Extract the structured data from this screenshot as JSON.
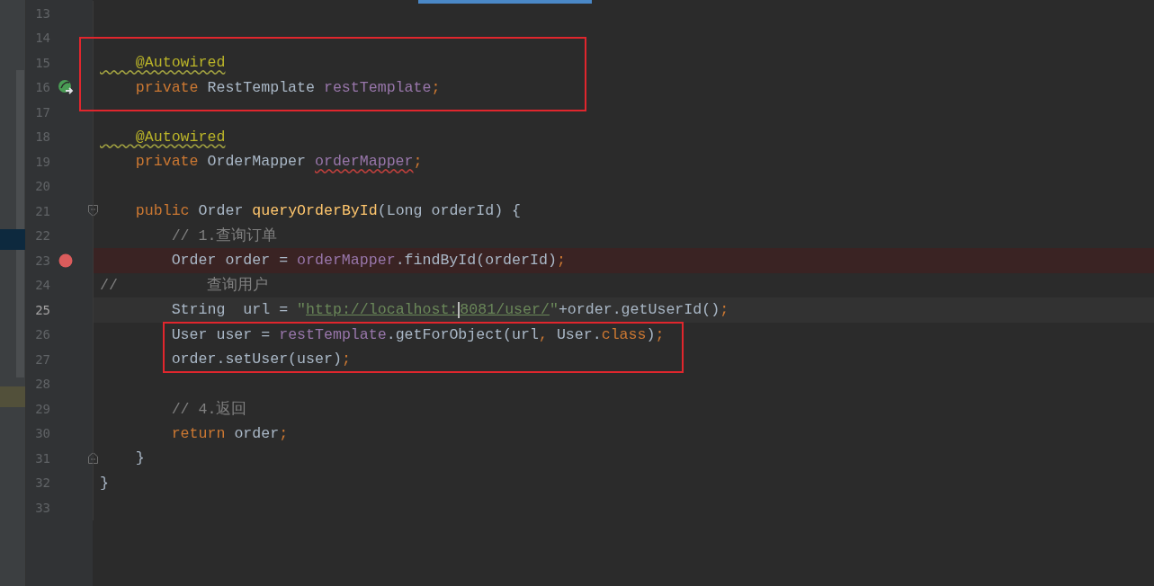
{
  "editor": {
    "sections": [
      {
        "boxed": false,
        "lines": [
          {
            "number": "13",
            "kind": "plain",
            "current": false
          },
          {
            "number": "14",
            "kind": "plain",
            "current": false
          }
        ]
      },
      {
        "boxed": true,
        "lines": [
          {
            "number": "15",
            "kind": "plain",
            "current": false,
            "tokens": [
              {
                "text": "    @Autowired",
                "kind": "annotation",
                "warning": true
              }
            ]
          },
          {
            "number": "16",
            "kind": "bean",
            "current": false,
            "tokens": [
              {
                "text": "    private ",
                "kind": "keyword"
              },
              {
                "text": "RestTemplate ",
                "kind": "plain"
              },
              {
                "text": "restTemplate",
                "kind": "field"
              },
              {
                "text": ";",
                "kind": "keyword"
              }
            ]
          }
        ]
      },
      {
        "boxed": false,
        "lines": [
          {
            "number": "17",
            "kind": "plain",
            "current": false
          },
          {
            "number": "18",
            "kind": "plain",
            "current": false,
            "tokens": [
              {
                "text": "    @Autowired",
                "kind": "annotation",
                "warning": true
              }
            ]
          },
          {
            "number": "19",
            "kind": "plain",
            "current": false,
            "tokens": [
              {
                "text": "    private ",
                "kind": "keyword"
              },
              {
                "text": "OrderMapper ",
                "kind": "plain"
              },
              {
                "text": "orderMapper",
                "kind": "field",
                "error": true
              },
              {
                "text": ";",
                "kind": "keyword"
              }
            ]
          },
          {
            "number": "20",
            "kind": "plain",
            "current": false
          },
          {
            "number": "21",
            "kind": "fold-start",
            "current": false,
            "tokens": [
              {
                "text": "    public ",
                "kind": "keyword"
              },
              {
                "text": "Order ",
                "kind": "plain"
              },
              {
                "text": "queryOrderById",
                "kind": "method"
              },
              {
                "text": "(Long orderId) {",
                "kind": "plain"
              }
            ]
          },
          {
            "number": "22",
            "kind": "plain",
            "current": false,
            "tokens": [
              {
                "text": "        // 1.查询订单",
                "kind": "comment"
              }
            ]
          },
          {
            "number": "23",
            "kind": "breakpoint",
            "current": false,
            "tokens": [
              {
                "text": "        Order order = ",
                "kind": "plain"
              },
              {
                "text": "orderMapper",
                "kind": "field"
              },
              {
                "text": ".findById(orderId)",
                "kind": "plain"
              },
              {
                "text": ";",
                "kind": "keyword"
              }
            ]
          },
          {
            "number": "24",
            "kind": "plain",
            "current": false,
            "tokens": [
              {
                "text": "//          查询用户",
                "kind": "comment"
              }
            ]
          },
          {
            "number": "25",
            "kind": "plain",
            "current": true,
            "tokens": [
              {
                "text": "        String  url = ",
                "kind": "plain"
              },
              {
                "text": "\"",
                "kind": "string"
              },
              {
                "text": "http://localhost:",
                "kind": "string",
                "link": true
              },
              {
                "text": "8081/user/",
                "kind": "string",
                "link": true,
                "caret_before": true
              },
              {
                "text": "\"",
                "kind": "string"
              },
              {
                "text": "+order.getUserId()",
                "kind": "plain"
              },
              {
                "text": ";",
                "kind": "keyword"
              }
            ]
          }
        ]
      },
      {
        "boxed": true,
        "lines": [
          {
            "number": "26",
            "kind": "plain",
            "current": false,
            "tokens": [
              {
                "text": "        User user = ",
                "kind": "plain"
              },
              {
                "text": "restTemplate",
                "kind": "field"
              },
              {
                "text": ".getForObject(url",
                "kind": "plain"
              },
              {
                "text": ", ",
                "kind": "keyword"
              },
              {
                "text": "User.",
                "kind": "plain"
              },
              {
                "text": "class",
                "kind": "keyword"
              },
              {
                "text": ")",
                "kind": "plain"
              },
              {
                "text": ";",
                "kind": "keyword"
              }
            ]
          },
          {
            "number": "27",
            "kind": "plain",
            "current": false,
            "tokens": [
              {
                "text": "        order.setUser(user)",
                "kind": "plain"
              },
              {
                "text": ";",
                "kind": "keyword"
              }
            ]
          }
        ]
      },
      {
        "boxed": false,
        "lines": [
          {
            "number": "28",
            "kind": "plain",
            "current": false
          },
          {
            "number": "29",
            "kind": "plain",
            "current": false,
            "tokens": [
              {
                "text": "        // 4.返回",
                "kind": "comment"
              }
            ]
          },
          {
            "number": "30",
            "kind": "plain",
            "current": false,
            "tokens": [
              {
                "text": "        return ",
                "kind": "keyword"
              },
              {
                "text": "order",
                "kind": "plain"
              },
              {
                "text": ";",
                "kind": "keyword"
              }
            ]
          },
          {
            "number": "31",
            "kind": "fold-end",
            "current": false,
            "tokens": [
              {
                "text": "    }",
                "kind": "plain"
              }
            ]
          },
          {
            "number": "32",
            "kind": "plain",
            "current": false,
            "tokens": [
              {
                "text": "}",
                "kind": "plain"
              }
            ]
          },
          {
            "number": "33",
            "kind": "plain",
            "current": false
          }
        ]
      }
    ]
  }
}
